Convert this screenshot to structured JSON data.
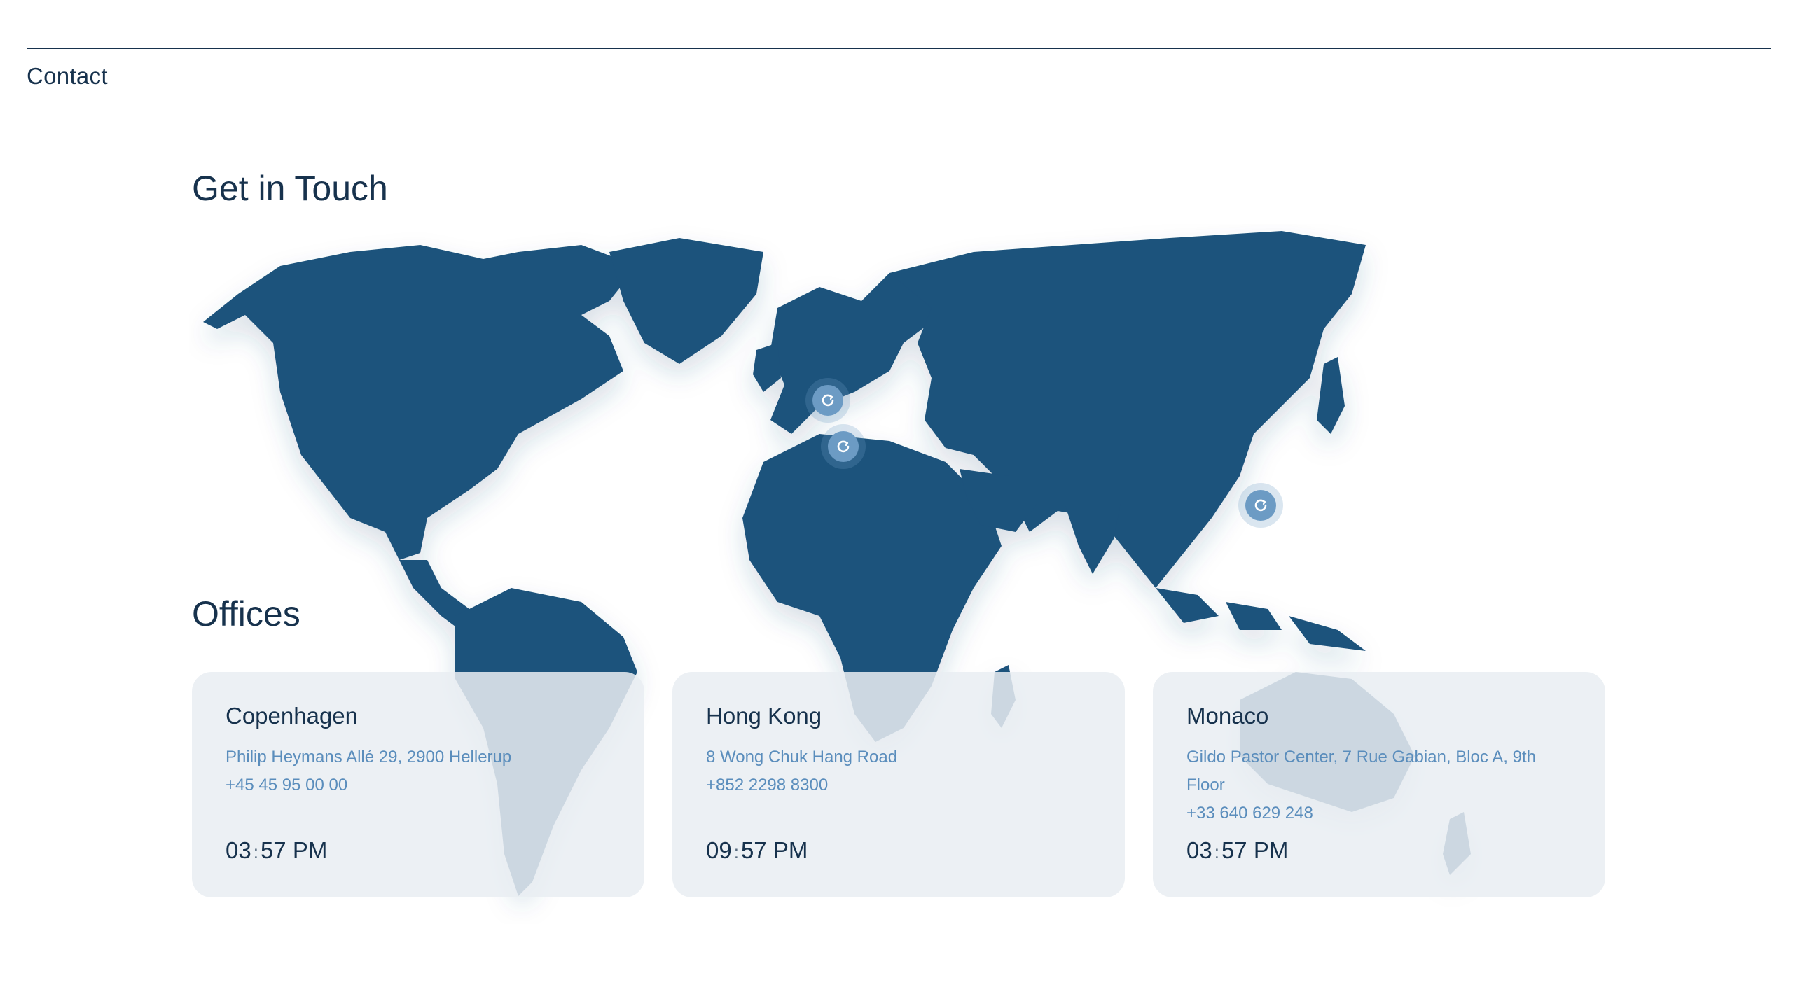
{
  "section_label": "Contact",
  "get_in_touch_heading": "Get in Touch",
  "offices_heading": "Offices",
  "map": {
    "land_color": "#1f527c",
    "marker_color": "#6c9bc4",
    "marker_icon": "refresh-icon"
  },
  "offices": [
    {
      "city": "Copenhagen",
      "address": "Philip Heymans Allé 29, 2900 Hellerup",
      "phone": "+45 45 95 00 00",
      "time_hours": "03",
      "time_separator": ":",
      "time_minutes": "57",
      "time_suffix": "PM"
    },
    {
      "city": "Hong Kong",
      "address": "8 Wong Chuk Hang Road",
      "phone": "+852 2298 8300",
      "time_hours": "09",
      "time_separator": ":",
      "time_minutes": "57",
      "time_suffix": "PM"
    },
    {
      "city": "Monaco",
      "address": "Gildo Pastor Center, 7 Rue Gabian, Bloc A, 9th Floor",
      "phone": "+33 640 629 248",
      "time_hours": "03",
      "time_separator": ":",
      "time_minutes": "57",
      "time_suffix": "PM"
    }
  ]
}
